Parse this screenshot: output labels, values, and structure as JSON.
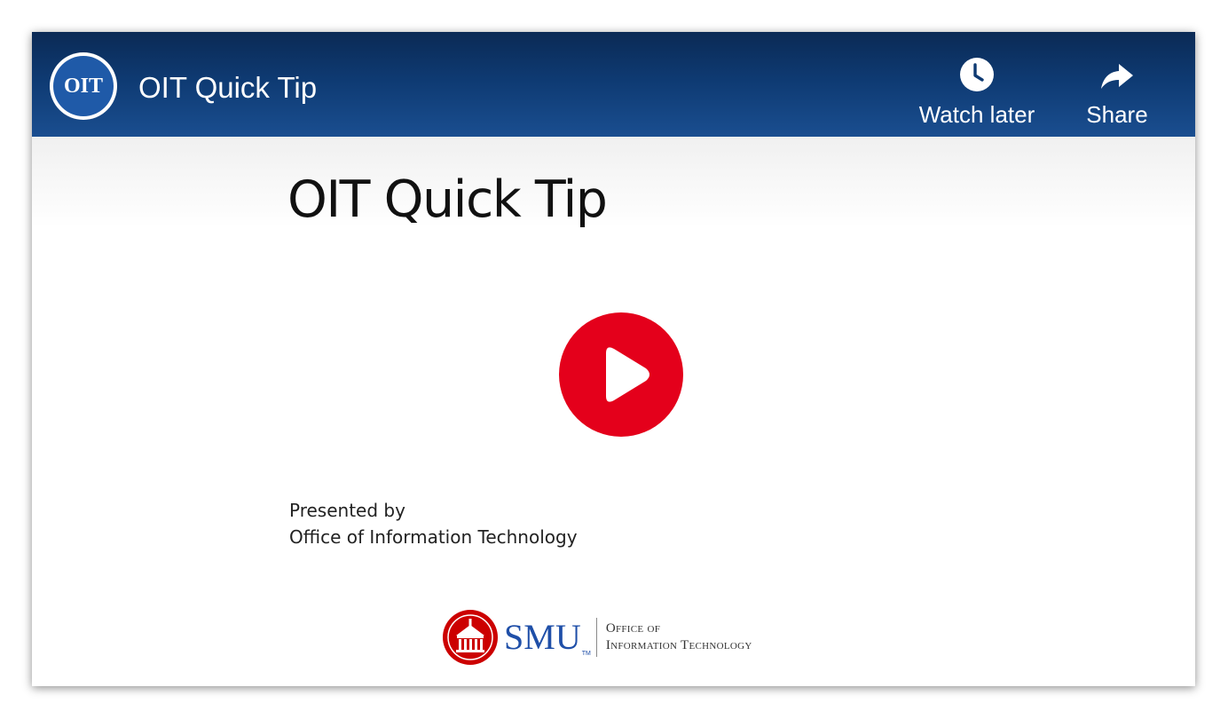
{
  "channel": {
    "avatar_text": "OIT"
  },
  "header": {
    "title": "OIT Quick Tip",
    "actions": [
      {
        "label": "Watch later",
        "icon": "clock-icon"
      },
      {
        "label": "Share",
        "icon": "share-arrow-icon"
      }
    ]
  },
  "slide": {
    "title": "OIT Quick Tip",
    "presented_line1": "Presented by",
    "presented_line2": "Office of Information Technology"
  },
  "play": {
    "icon": "play-icon",
    "color": "#e4001b"
  },
  "logo": {
    "word": "SMU",
    "tm": "TM",
    "line1": "Office of",
    "line2": "Information Technology"
  },
  "colors": {
    "header_bar": "#0e3a72",
    "smu_blue": "#1f4fa8",
    "smu_red": "#cc0000"
  }
}
